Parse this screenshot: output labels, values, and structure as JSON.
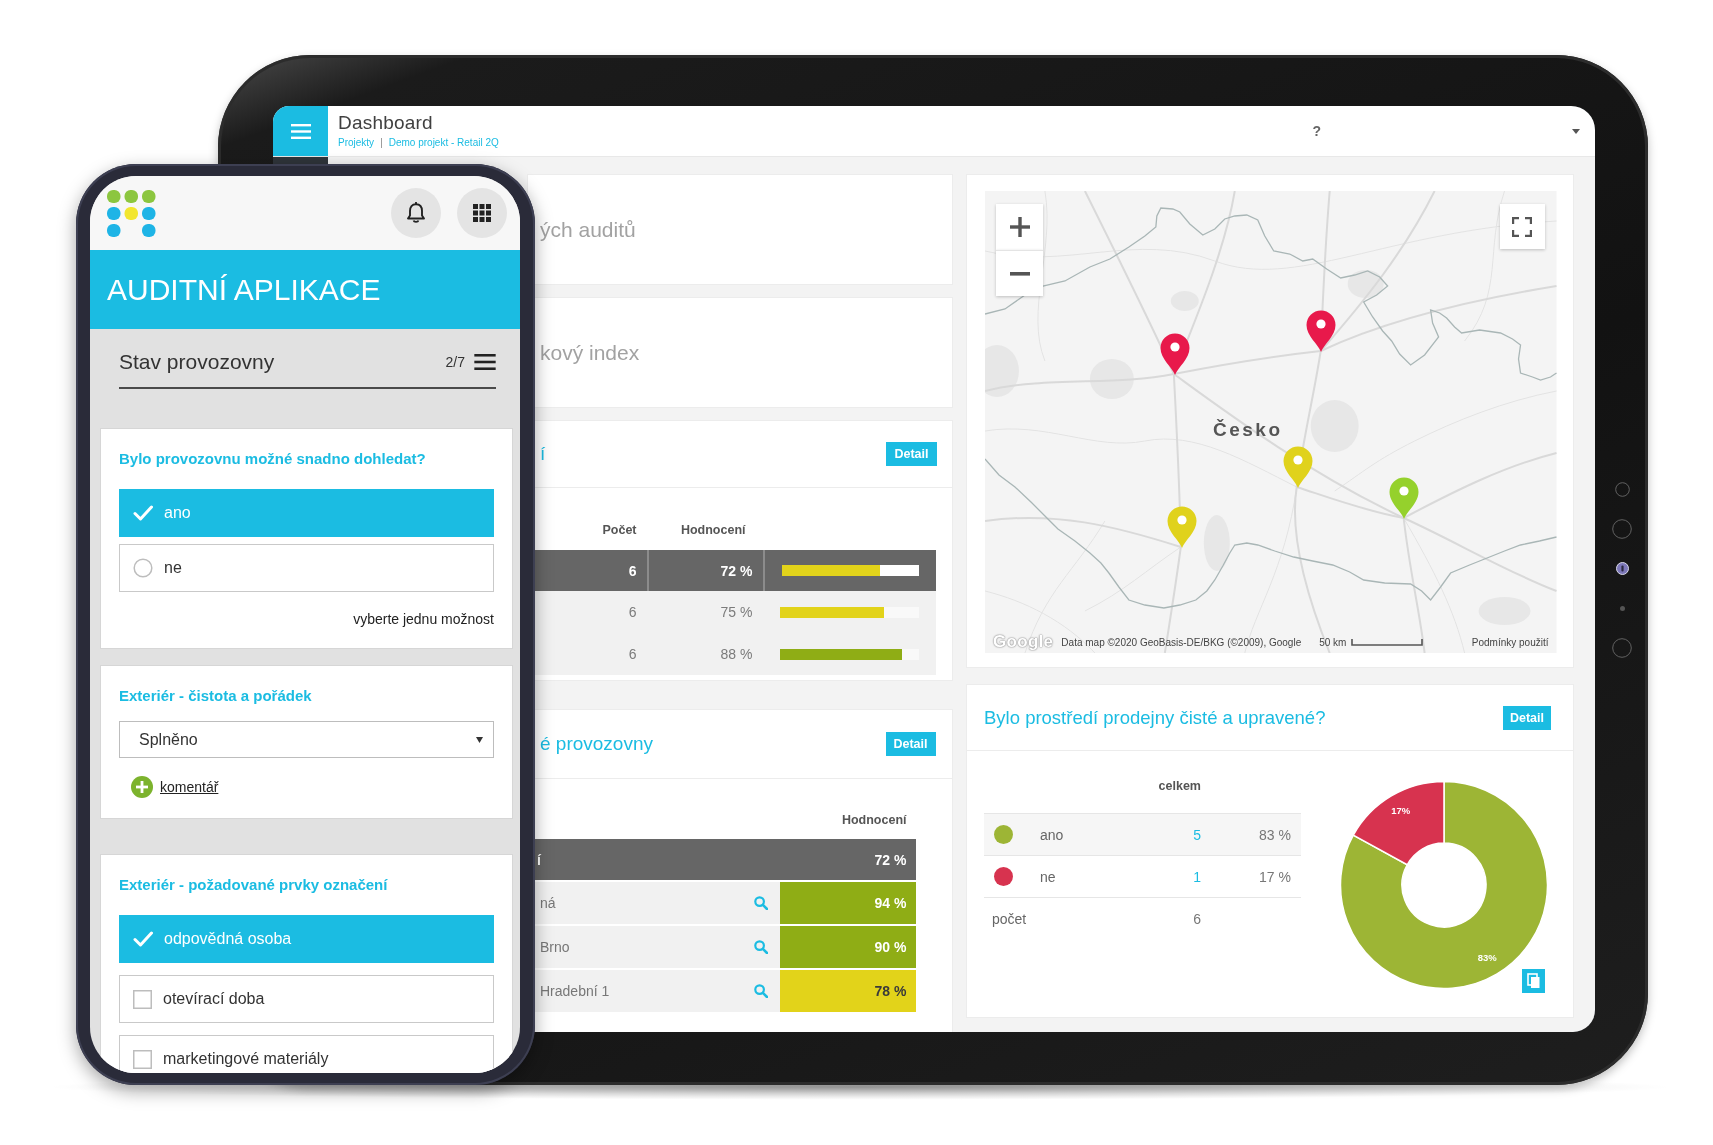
{
  "tablet": {
    "header": {
      "title": "Dashboard",
      "breadcrumb": {
        "items": [
          "Projekty",
          "Demo projekt - Retail 2Q"
        ],
        "separator": "|"
      },
      "help": "?"
    },
    "left_widgets": [
      {
        "kind": "stat",
        "title": "ých auditů"
      },
      {
        "kind": "stat",
        "title": "kový index"
      },
      {
        "kind": "bar_table",
        "title": "í",
        "button": "Detail",
        "columns": [
          "Počet",
          "Hodnocení"
        ],
        "rows": [
          {
            "kind": "total",
            "count": "6",
            "score": "72 %",
            "level": 0.72,
            "color": "#e2d31a"
          },
          {
            "kind": "item",
            "count": "6",
            "score": "75 %",
            "level": 0.75,
            "color": "#e2d31a"
          },
          {
            "kind": "item",
            "count": "6",
            "score": "88 %",
            "level": 0.88,
            "color": "#8fad15"
          }
        ]
      },
      {
        "kind": "score_table",
        "title": "é provozovny",
        "button": "Detail",
        "columns": [
          "Hodnocení"
        ],
        "rows": [
          {
            "kind": "total",
            "name": "í",
            "score": "72 %"
          },
          {
            "kind": "item",
            "name": "ná",
            "score": "94 %",
            "color": "#8fad15"
          },
          {
            "kind": "item",
            "name": "Brno",
            "score": "90 %",
            "color": "#8fad15"
          },
          {
            "kind": "item",
            "name": "Hradební 1",
            "score": "78 %",
            "color": "#e2d31a"
          }
        ]
      }
    ],
    "map": {
      "label": "Česko",
      "pins": [
        {
          "color": "#e8194b"
        },
        {
          "color": "#e8194b"
        },
        {
          "color": "#e0d21c"
        },
        {
          "color": "#95d12c"
        },
        {
          "color": "#e0d21c"
        }
      ],
      "attribution": {
        "logo": "Google",
        "data": "Data map ©2020 GeoBasis-DE/BKG (©2009), Google",
        "scale": "50 km",
        "terms": "Podmínky použití"
      }
    },
    "answer_widget": {
      "title": "Bylo prostředí prodejny čisté a upravené?",
      "button": "Detail",
      "column": "celkem",
      "rows": [
        {
          "kind": "answer",
          "label": "ano",
          "color": "#9db535",
          "count": "5",
          "percent": "83 %"
        },
        {
          "kind": "answer",
          "label": "ne",
          "color": "#d7334f",
          "count": "1",
          "percent": "17 %"
        },
        {
          "kind": "total",
          "label": "počet",
          "count": "6"
        }
      ],
      "chart_data": {
        "type": "donut",
        "values": [
          83,
          17
        ],
        "value_labels": [
          "83%",
          "17%"
        ]
      }
    }
  },
  "phone": {
    "banner": {
      "title": "AUDITNÍ APLIKACE"
    },
    "section": {
      "title": "Stav provozovny",
      "progress": "2/7"
    },
    "questions": [
      {
        "kind": "single_choice",
        "title": "Bylo provozovnu možné snadno dohledat?",
        "options": [
          {
            "label": "ano",
            "selected": true
          },
          {
            "label": "ne",
            "selected": false
          }
        ],
        "hint": "vyberte jednu možnost"
      },
      {
        "kind": "dropdown",
        "title": "Exteriér - čistota a pořádek",
        "value": "Splněno",
        "comment": "komentář"
      },
      {
        "kind": "multi_choice",
        "title": "Exteriér - požadované prvky označení",
        "options": [
          {
            "label": "odpovědná osoba",
            "checked": true
          },
          {
            "label": "otevírací doba",
            "checked": false
          },
          {
            "label": "marketingové materiály",
            "checked": false
          }
        ]
      }
    ]
  }
}
